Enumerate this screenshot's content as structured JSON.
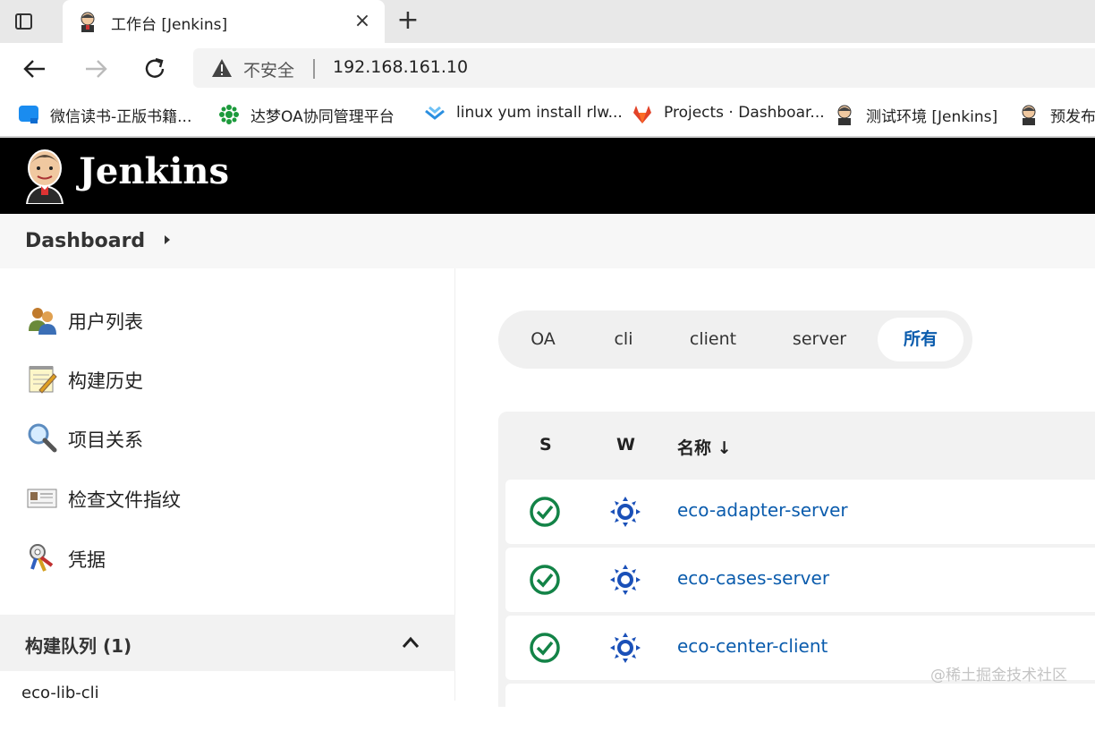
{
  "browser": {
    "tab": {
      "title": "工作台 [Jenkins]",
      "close_glyph": "×",
      "favicon": "jenkins-icon"
    },
    "new_tab_glyph": "+",
    "nav": {
      "back_glyph": "←",
      "forward_glyph": "→",
      "reload_glyph": "↻"
    },
    "address": {
      "security_label": "不安全",
      "url": "192.168.161.10"
    },
    "bookmarks": [
      {
        "label": "微信读书-正版书籍...",
        "icon": "weread-icon"
      },
      {
        "label": "达梦OA协同管理平台",
        "icon": "dameng-icon"
      },
      {
        "label": "linux yum install rlw...",
        "icon": "chevron-bookmark-icon"
      },
      {
        "label": "Projects · Dashboar...",
        "icon": "gitlab-icon"
      },
      {
        "label": "测试环境 [Jenkins]",
        "icon": "jenkins-icon"
      },
      {
        "label": "预发布",
        "icon": "jenkins-icon"
      }
    ]
  },
  "header": {
    "title": "Jenkins"
  },
  "breadcrumb": {
    "item": "Dashboard"
  },
  "side_panel": {
    "items": [
      {
        "label": "用户列表",
        "icon": "users-icon"
      },
      {
        "label": "构建历史",
        "icon": "notepad-icon"
      },
      {
        "label": "项目关系",
        "icon": "magnifier-icon"
      },
      {
        "label": "检查文件指纹",
        "icon": "fingerprint-card-icon"
      },
      {
        "label": "凭据",
        "icon": "keys-icon"
      }
    ],
    "queue": {
      "title": "构建队列 (1)",
      "items": [
        "eco-lib-cli"
      ]
    }
  },
  "views": {
    "tabs": [
      {
        "label": "OA",
        "active": false
      },
      {
        "label": "cli",
        "active": false
      },
      {
        "label": "client",
        "active": false
      },
      {
        "label": "server",
        "active": false
      },
      {
        "label": "所有",
        "active": true
      }
    ]
  },
  "jobs": {
    "columns": {
      "status": "S",
      "weather": "W",
      "name": "名称 ↓"
    },
    "rows": [
      {
        "name": "eco-adapter-server",
        "status": "success",
        "weather": "sunny"
      },
      {
        "name": "eco-cases-server",
        "status": "success",
        "weather": "sunny"
      },
      {
        "name": "eco-center-client",
        "status": "success",
        "weather": "sunny"
      }
    ]
  },
  "colors": {
    "link": "#0b5cad",
    "success": "#138347",
    "weather": "#1a50b8",
    "header_bg": "#000000"
  },
  "watermark": "@稀土掘金技术社区"
}
